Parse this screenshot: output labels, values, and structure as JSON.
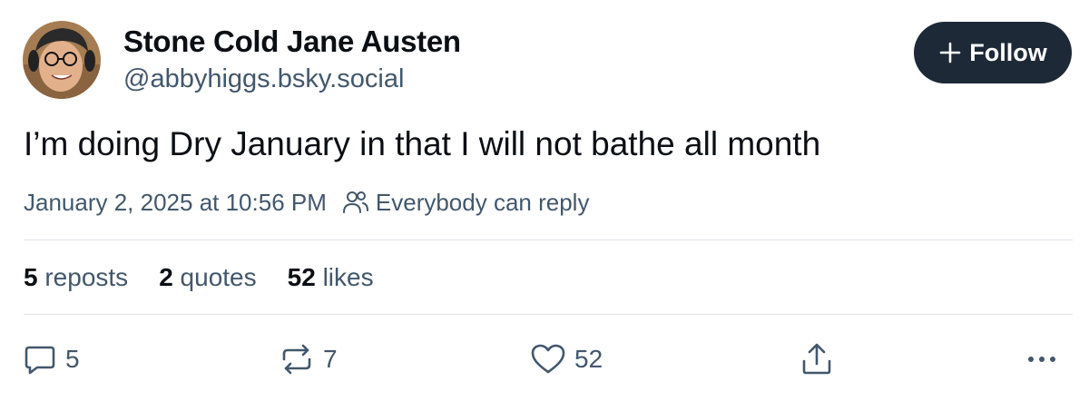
{
  "author": {
    "display_name": "Stone Cold Jane Austen",
    "handle": "@abbyhiggs.bsky.social"
  },
  "follow_button": {
    "label": "Follow",
    "icon": "plus-icon"
  },
  "post": {
    "text": "I’m doing Dry January in that I will not bathe all month",
    "timestamp": "January 2, 2025 at 10:56 PM",
    "reply_setting": "Everybody can reply"
  },
  "stats": {
    "reposts": {
      "count": "5",
      "label": "reposts"
    },
    "quotes": {
      "count": "2",
      "label": "quotes"
    },
    "likes": {
      "count": "52",
      "label": "likes"
    }
  },
  "actions": {
    "reply": {
      "count": "5",
      "icon": "reply-bubble-icon"
    },
    "repost": {
      "count": "7",
      "icon": "repost-icon"
    },
    "like": {
      "count": "52",
      "icon": "heart-icon"
    },
    "share": {
      "icon": "share-icon"
    },
    "more": {
      "icon": "more-dots-icon"
    }
  },
  "colors": {
    "text_primary": "#0b0f14",
    "text_secondary": "#42576c",
    "follow_button_bg": "#1e2937",
    "divider": "#dfe3e8"
  }
}
